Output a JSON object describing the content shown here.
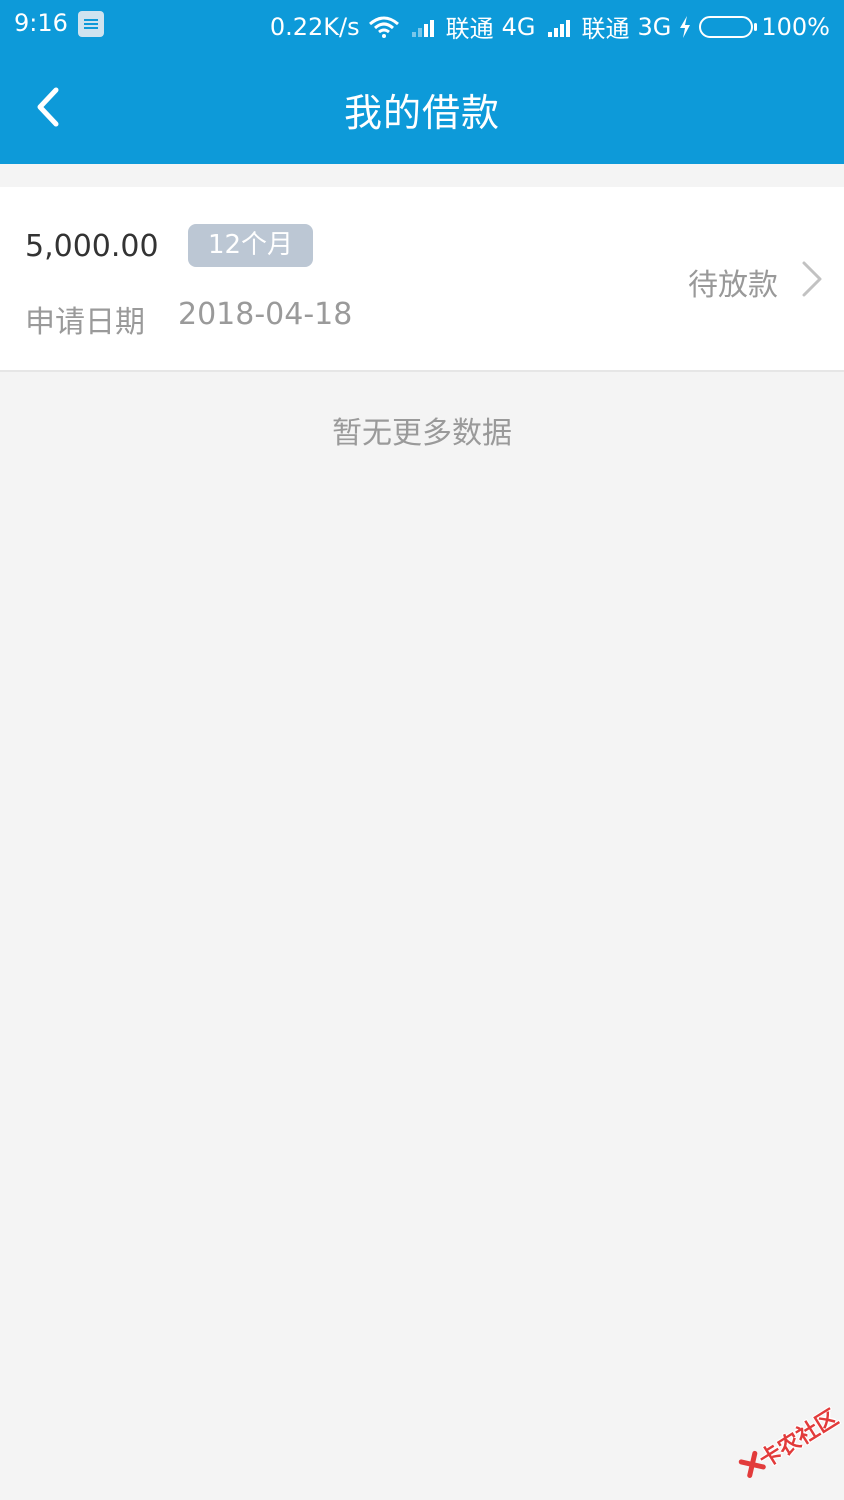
{
  "status_bar": {
    "time": "9:16",
    "net_speed": "0.22K/s",
    "carrier1": "联通",
    "network1": "4G",
    "carrier2": "联通",
    "network2": "3G",
    "battery": "100%"
  },
  "header": {
    "title": "我的借款",
    "back_icon": "chevron-left-icon"
  },
  "loans": [
    {
      "amount": "5,000.00",
      "term": "12个月",
      "date_label": "申请日期",
      "date": "2018-04-18",
      "status": "待放款"
    }
  ],
  "empty_message": "暂无更多数据",
  "watermark": "卡农社区",
  "colors": {
    "header_bg": "#0d9ad9",
    "page_bg": "#f4f4f4",
    "badge_bg": "#bcc7d4",
    "watermark": "#e23b3b"
  }
}
